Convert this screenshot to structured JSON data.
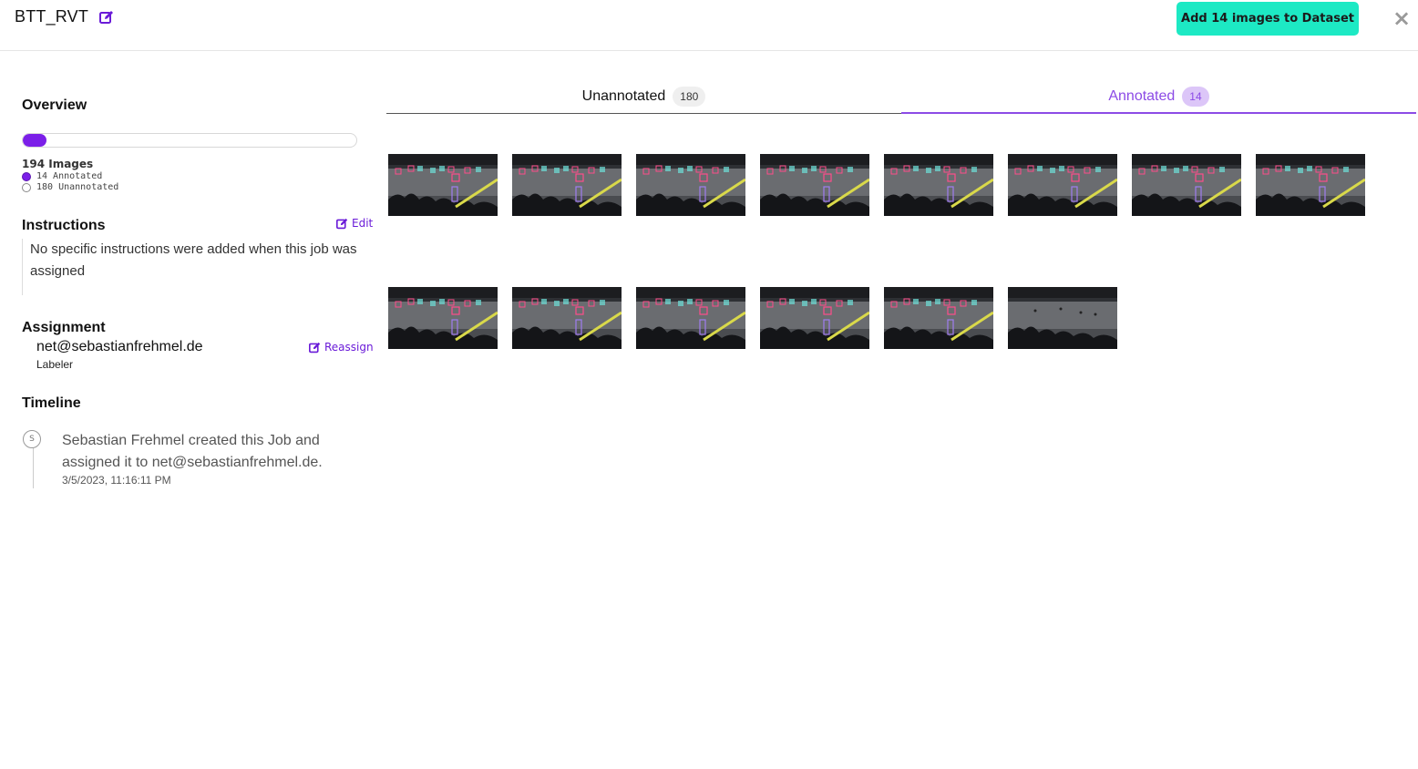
{
  "header": {
    "title": "BTT_RVT",
    "add_button_label": "Add 14 images to Dataset",
    "close_symbol": "×"
  },
  "sidebar": {
    "overview": {
      "title": "Overview",
      "progress_fraction": 0.0722,
      "image_count": "194 Images",
      "annotated_label": "14 Annotated",
      "unannotated_label": "180 Unannotated"
    },
    "instructions": {
      "title": "Instructions",
      "edit_label": "Edit",
      "text": "No specific instructions were added when this job was assigned"
    },
    "assignment": {
      "title": "Assignment",
      "assignee": "net@sebastianfrehmel.de",
      "role": "Labeler",
      "reassign_label": "Reassign"
    },
    "timeline": {
      "title": "Timeline",
      "avatar_initial": "S",
      "event_text": "Sebastian Frehmel created this Job and assigned it to net@sebastianfrehmel.de.",
      "event_date": "3/5/2023, 11:16:11 PM"
    }
  },
  "tabs": [
    {
      "label": "Unannotated",
      "count": "180",
      "active": false
    },
    {
      "label": "Annotated",
      "count": "14",
      "active": true
    }
  ],
  "colors": {
    "accent": "#8c4be6",
    "progress": "#7b1fe8",
    "primary_button": "#1de9c4"
  },
  "icons": {
    "title_edit": "edit-icon",
    "close": "close-icon"
  },
  "thumbnails": [
    {
      "annotated": true
    },
    {
      "annotated": true
    },
    {
      "annotated": true
    },
    {
      "annotated": true
    },
    {
      "annotated": true
    },
    {
      "annotated": true
    },
    {
      "annotated": true
    },
    {
      "annotated": true
    },
    {
      "annotated": true
    },
    {
      "annotated": true
    },
    {
      "annotated": true
    },
    {
      "annotated": true
    },
    {
      "annotated": true
    },
    {
      "annotated": false
    }
  ]
}
